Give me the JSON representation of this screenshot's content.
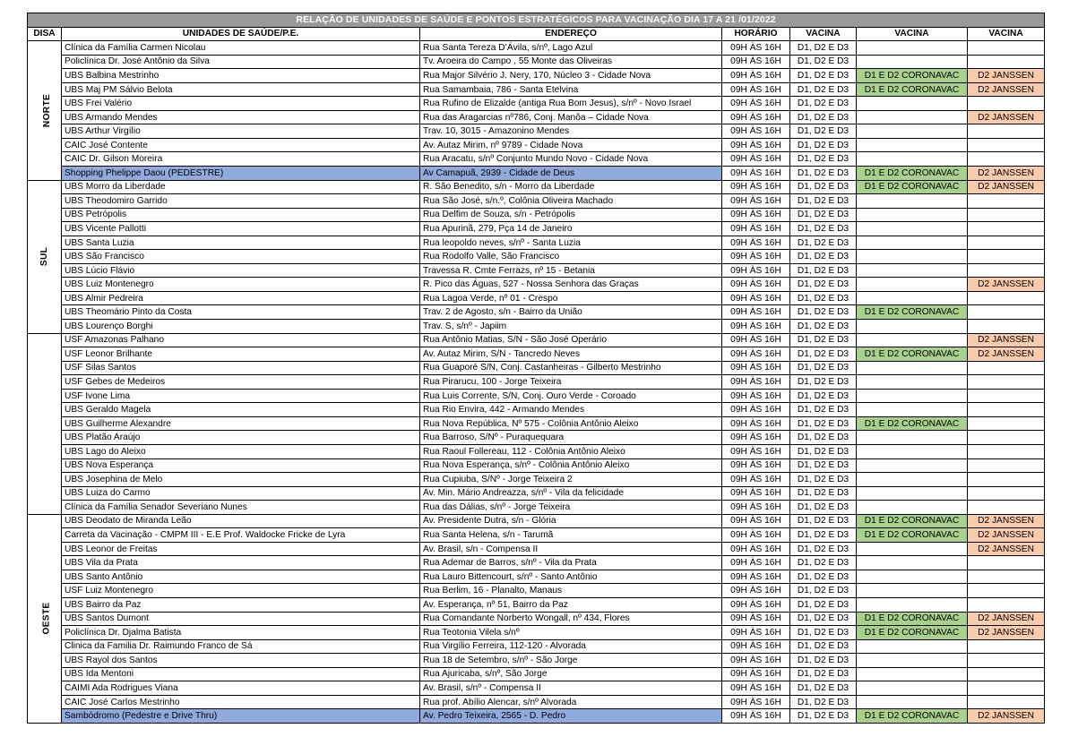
{
  "title": "RELAÇÃO DE UNIDADES DE SAÚDE E PONTOS ESTRATÉGICOS PARA VACINAÇÃO DIA 17 A 21 /01/2022",
  "headers": [
    "DISA",
    "UNIDADES DE SAÚDE/P.E.",
    "ENDEREÇO",
    "HORÁRIO",
    "VACINA",
    "VACINA",
    "VACINA"
  ],
  "colors": {
    "title_bg": "#999999",
    "highlight_row": "#8faadc",
    "coronavac": "#a9d18e",
    "janssen": "#f8cbad"
  },
  "groups": [
    {
      "disa": "NORTE",
      "rows": [
        {
          "unit": "Clínica da Família Carmen Nicolau",
          "address": "Rua Santa Tereza D’Ávila, s/nº, Lago Azul",
          "hours": "09H ÀS 16H",
          "v1": "D1, D2 E D3",
          "v2": "",
          "v3": ""
        },
        {
          "unit": "Policlínica Dr. José Antônio da Silva",
          "address": "Tv. Aroeira do Campo , 55 Monte das Oliveiras",
          "hours": "09H ÀS 16H",
          "v1": "D1, D2 E D3",
          "v2": "",
          "v3": ""
        },
        {
          "unit": "UBS Balbina Mestrinho",
          "address": "Rua Major Silvério J. Nery, 170, Núcleo 3 - Cidade Nova",
          "hours": "09H ÀS 16H",
          "v1": "D1, D2 E D3",
          "v2": "D1 E D2 CORONAVAC",
          "v3": "D2  JANSSEN"
        },
        {
          "unit": "UBS Maj PM Sálvio Belota",
          "address": "Rua Samambaia, 786 - Santa Etelvina",
          "hours": "09H ÀS 16H",
          "v1": "D1, D2 E D3",
          "v2": "D1 E D2 CORONAVAC",
          "v3": "D2  JANSSEN"
        },
        {
          "unit": "UBS Frei Valério",
          "address": "Rua Rufino de Elizalde (antiga Rua Bom Jesus), s/nº - Novo Israel",
          "hours": "09H ÀS 16H",
          "v1": "D1, D2 E D3",
          "v2": "",
          "v3": ""
        },
        {
          "unit": "UBS Armando Mendes",
          "address": "Rua das Aragarcias nº786, Conj. Manôa – Cidade Nova",
          "hours": "09H ÀS 16H",
          "v1": "D1, D2 E D3",
          "v2": "",
          "v3": "D2  JANSSEN"
        },
        {
          "unit": "UBS Arthur Virgílio",
          "address": "Trav. 10, 3015 - Amazonino Mendes",
          "hours": "09H ÀS 16H",
          "v1": "D1, D2 E D3",
          "v2": "",
          "v3": ""
        },
        {
          "unit": "CAIC José Contente",
          "address": "Av. Autaz Mirim, nº 9789 - Cidade Nova",
          "hours": "09H ÀS 16H",
          "v1": "D1, D2 E D3",
          "v2": "",
          "v3": ""
        },
        {
          "unit": "CAIC Dr. Gilson Moreira",
          "address": "Rua Aracatu, s/nº Conjunto Mundo Novo - Cidade Nova",
          "hours": "09H ÀS 16H",
          "v1": "D1, D2 E D3",
          "v2": "",
          "v3": ""
        },
        {
          "unit": "Shopping Phelippe Daou (PEDESTRE)",
          "address": "Av Camapuã, 2939 - Cidade de Deus",
          "hours": "09H ÀS 16H",
          "v1": "D1, D2 E D3",
          "v2": "D1 E D2 CORONAVAC",
          "v3": "D2  JANSSEN",
          "highlight": true
        }
      ]
    },
    {
      "disa": "SUL",
      "rows": [
        {
          "unit": "UBS Morro da Liberdade",
          "address": " R. São Benedito, s/n - Morro da Liberdade",
          "hours": "09H ÀS 16H",
          "v1": "D1, D2 E D3",
          "v2": "D1 E D2 CORONAVAC",
          "v3": "D2  JANSSEN"
        },
        {
          "unit": "UBS Theodomiro Garrido",
          "address": "Rua São José, s/n.º, Colônia Oliveira Machado",
          "hours": "09H ÀS 16H",
          "v1": "D1, D2 E D3",
          "v2": "",
          "v3": ""
        },
        {
          "unit": "UBS Petrópolis",
          "address": "Rua Delfim de Souza, s/n - Petrópolis",
          "hours": "09H ÀS 16H",
          "v1": "D1, D2 E D3",
          "v2": "",
          "v3": ""
        },
        {
          "unit": "UBS Vicente Pallotti",
          "address": "Rua Apurinã, 279, Pça 14 de Janeiro",
          "hours": "09H ÀS 16H",
          "v1": "D1, D2 E D3",
          "v2": "",
          "v3": ""
        },
        {
          "unit": "UBS Santa Luzia",
          "address": "Rua leopoldo neves, s/nº - Santa Luzia",
          "hours": "09H ÀS 16H",
          "v1": "D1, D2 E D3",
          "v2": "",
          "v3": ""
        },
        {
          "unit": "UBS São Francisco",
          "address": "Rua Rodolfo Valle, São Francisco",
          "hours": "09H ÀS 16H",
          "v1": "D1, D2 E D3",
          "v2": "",
          "v3": ""
        },
        {
          "unit": "UBS Lúcio Flávio",
          "address": "Travessa R. Cmte Ferrazs, nº 15 - Betania",
          "hours": "09H ÀS 16H",
          "v1": "D1, D2 E D3",
          "v2": "",
          "v3": ""
        },
        {
          "unit": "UBS Luiz Montenegro",
          "address": "R. Pico das Águas, 527 - Nossa Senhora das Graças",
          "hours": "09H ÀS 16H",
          "v1": "D1, D2 E D3",
          "v2": "",
          "v3": "D2  JANSSEN"
        },
        {
          "unit": "UBS Almir Pedreira",
          "address": "Rua Lagoa Verde, nº 01 - Crespo",
          "hours": "09H ÀS 16H",
          "v1": "D1, D2 E D3",
          "v2": "",
          "v3": ""
        },
        {
          "unit": "UBS Theomário Pinto da Costa",
          "address": "Trav. 2 de Agosto, s/n - Bairro da União",
          "hours": "09H ÀS 16H",
          "v1": "D1, D2 E D3",
          "v2": "D1 E D2 CORONAVAC",
          "v3": ""
        },
        {
          "unit": "UBS Lourenço Borghi",
          "address": "Trav. S, s/nº - Japiim",
          "hours": "09H ÀS 16H",
          "v1": "D1, D2 E D3",
          "v2": "",
          "v3": ""
        }
      ]
    },
    {
      "disa": "",
      "rows": [
        {
          "unit": "USF Amazonas Palhano",
          "address": "Rua Antônio Matias, S/N - São José Operário",
          "hours": "09H ÀS 16H",
          "v1": "D1, D2 E D3",
          "v2": "",
          "v3": "D2  JANSSEN"
        },
        {
          "unit": "USF Leonor Brilhante",
          "address": "Av. Autaz Mirim, S/N - Tancredo Neves",
          "hours": "09H ÀS 16H",
          "v1": "D1, D2 E D3",
          "v2": "D1 E D2 CORONAVAC",
          "v3": "D2  JANSSEN"
        },
        {
          "unit": "USF Silas Santos",
          "address": "Rua Guaporé S/N, Conj. Castanheiras - Gilberto Mestrinho",
          "hours": "09H ÀS 16H",
          "v1": "D1, D2 E D3",
          "v2": "",
          "v3": ""
        },
        {
          "unit": "USF Gebes de Medeiros",
          "address": "Rua Pirarucu, 100 - Jorge Teixeira",
          "hours": "09H ÀS 16H",
          "v1": "D1, D2 E D3",
          "v2": "",
          "v3": ""
        },
        {
          "unit": "USF Ivone Lima",
          "address": "Rua Luis Corrente, S/N, Conj. Ouro Verde - Coroado",
          "hours": "09H ÀS 16H",
          "v1": "D1, D2 E D3",
          "v2": "",
          "v3": ""
        },
        {
          "unit": "UBS Geraldo Magela",
          "address": "Rua Rio Envira, 442 - Armando Mendes",
          "hours": "09H ÀS 16H",
          "v1": "D1, D2 E D3",
          "v2": "",
          "v3": ""
        },
        {
          "unit": "UBS Guilherme Alexandre",
          "address": "Rua Nova República, Nº 575 - Colônia Antônio Aleixo",
          "hours": "09H ÀS 16H",
          "v1": "D1, D2 E D3",
          "v2": "D1 E D2 CORONAVAC",
          "v3": ""
        },
        {
          "unit": "UBS Platão Araújo",
          "address": "Rua Barroso, S/Nº - Puraquequara",
          "hours": "09H ÀS 16H",
          "v1": "D1, D2 E D3",
          "v2": "",
          "v3": ""
        },
        {
          "unit": "UBS Lago do Aleixo",
          "address": "Rua Raoul Follereau, 112 - Colônia Antônio Aleixo",
          "hours": "09H ÀS 16H",
          "v1": "D1, D2 E D3",
          "v2": "",
          "v3": ""
        },
        {
          "unit": "UBS Nova Esperança",
          "address": "Rua Nova Esperança, s/nº - Colônia Antônio Aleixo",
          "hours": "09H ÀS 16H",
          "v1": "D1, D2 E D3",
          "v2": "",
          "v3": ""
        },
        {
          "unit": "UBS Josephina de Melo",
          "address": "Rua Cupiuba, S/Nº -  Jorge Teixeira 2",
          "hours": "09H ÀS 16H",
          "v1": "D1, D2 E D3",
          "v2": "",
          "v3": ""
        },
        {
          "unit": "UBS Luiza do Carmo",
          "address": "Av. Min. Mário Andreazza, s/nº - Vila da felicidade",
          "hours": "09H ÀS 16H",
          "v1": "D1, D2 E D3",
          "v2": "",
          "v3": ""
        },
        {
          "unit": "Clínica da Família Senador Severiano Nunes",
          "address": "Rua das Dálias, s/nº - Jorge Teixeira",
          "hours": "09H ÀS 16H",
          "v1": "D1, D2 E D3",
          "v2": "",
          "v3": ""
        }
      ]
    },
    {
      "disa": "OESTE",
      "rows": [
        {
          "unit": "UBS Deodato de Miranda Leão",
          "address": "Av. Presidente Dutra, s/n - Glória",
          "hours": "09H ÀS 16H",
          "v1": "D1, D2 E D3",
          "v2": "D1 E D2 CORONAVAC",
          "v3": "D2  JANSSEN"
        },
        {
          "unit": "Carreta da Vacinação - CMPM III - E.E Prof. Waldocke Fricke de Lyra",
          "address": "Rua Santa Helena, s/n - Tarumã",
          "hours": "09H ÀS 16H",
          "v1": "D1, D2 E D3",
          "v2": "D1 E D2 CORONAVAC",
          "v3": "D2  JANSSEN"
        },
        {
          "unit": "UBS Leonor de Freitas",
          "address": "Av. Brasil, s/n - Compensa II",
          "hours": "09H ÀS 16H",
          "v1": "D1, D2 E D3",
          "v2": "",
          "v3": "D2  JANSSEN"
        },
        {
          "unit": "UBS Vila da Prata",
          "address": "Rua Ademar de Barros, s/nº - Vila da Prata",
          "hours": "09H ÀS 16H",
          "v1": "D1, D2 E D3",
          "v2": "",
          "v3": ""
        },
        {
          "unit": "UBS Santo Antônio",
          "address": "Rua Lauro Bittencourt, s/nº - Santo Antônio",
          "hours": "09H ÀS 16H",
          "v1": "D1, D2 E D3",
          "v2": "",
          "v3": ""
        },
        {
          "unit": "USF Luiz Montenegro",
          "address": "Rua Berlim, 16 - Planalto, Manaus",
          "hours": "09H ÀS 16H",
          "v1": "D1, D2 E D3",
          "v2": "",
          "v3": ""
        },
        {
          "unit": "UBS Bairro da Paz",
          "address": "Av. Esperança, nº 51, Bairro da Paz",
          "hours": "09H ÀS 16H",
          "v1": "D1, D2 E D3",
          "v2": "",
          "v3": ""
        },
        {
          "unit": "UBS Santos Dumont",
          "address": "Rua Comandante Norberto Wongall, nº 434, Flores",
          "hours": "09H ÀS 16H",
          "v1": "D1, D2 E D3",
          "v2": "D1 E D2 CORONAVAC",
          "v3": "D2  JANSSEN"
        },
        {
          "unit": "Policlínica Dr. Djalma Batista",
          "address": "Rua Teotonia Vilela s/nº",
          "hours": "09H ÀS 16H",
          "v1": "D1, D2 E D3",
          "v2": "D1 E D2 CORONAVAC",
          "v3": "D2  JANSSEN"
        },
        {
          "unit": "Clinica da Familia Dr. Raimundo Franco de Sá",
          "address": "Rua Virgílio Ferreira, 112-120 - Alvorada",
          "hours": "09H ÀS 16H",
          "v1": "D1, D2 E D3",
          "v2": "",
          "v3": ""
        },
        {
          "unit": "UBS Rayol dos Santos",
          "address": "Rua 18 de Setembro, s/nº - São Jorge",
          "hours": "09H ÀS 16H",
          "v1": "D1, D2 E D3",
          "v2": "",
          "v3": ""
        },
        {
          "unit": "UBS Ida Mentoni",
          "address": "Rua Ajuricaba, s/nº, São Jorge",
          "hours": "09H ÀS 16H",
          "v1": "D1, D2 E D3",
          "v2": "",
          "v3": ""
        },
        {
          "unit": "CAIMI Ada Rodrigues Viana",
          "address": "Av. Brasil, s/nº - Compensa II",
          "hours": "09H ÀS 16H",
          "v1": "D1, D2 E D3",
          "v2": "",
          "v3": ""
        },
        {
          "unit": "CAIC José Carlos Mestrinho",
          "address": "Rua prof. Abílio Alencar, s/nº Alvorada",
          "hours": "09H ÀS 16H",
          "v1": "D1, D2 E D3",
          "v2": "",
          "v3": ""
        },
        {
          "unit": "Sambódromo (Pedestre e  Drive Thru)",
          "address": "Av. Pedro Teixeira, 2565 - D. Pedro",
          "hours": "09H ÀS 16H",
          "v1": "D1, D2 E D3",
          "v2": "D1 E D2 CORONAVAC",
          "v3": "D2  JANSSEN",
          "highlight": true
        }
      ]
    }
  ]
}
